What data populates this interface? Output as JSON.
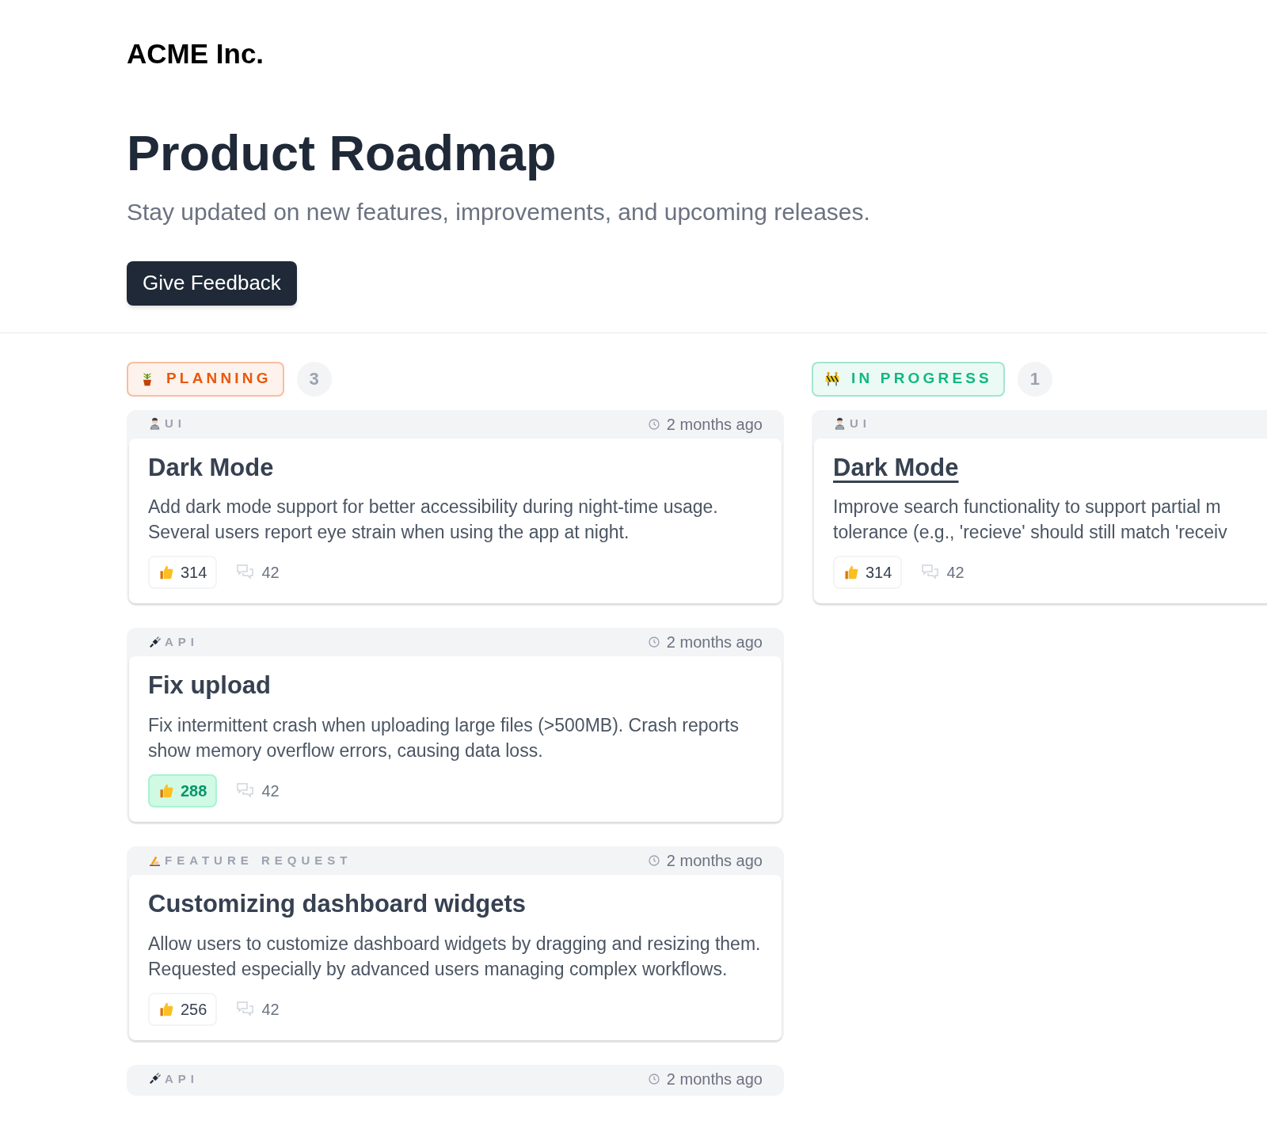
{
  "brand": "ACME Inc.",
  "title": "Product Roadmap",
  "subtitle": "Stay updated on new features, improvements, and upcoming releases.",
  "feedback_button": "Give Feedback",
  "columns": [
    {
      "kind": "planning",
      "label": "PLANNING",
      "color": "#ea580c",
      "count": "3",
      "cards": [
        {
          "tag": {
            "kind": "ui",
            "label": "UI"
          },
          "time": "2 months ago",
          "title": "Dark Mode",
          "hovered": false,
          "description": "Add dark mode support for better accessibility during night-time usage. Several users report eye strain when using the app at night.",
          "votes": "314",
          "voted": false,
          "comments": "42"
        },
        {
          "tag": {
            "kind": "api",
            "label": "API"
          },
          "time": "2 months ago",
          "title": "Fix upload",
          "hovered": false,
          "description": "Fix intermittent crash when uploading large files (>500MB). Crash reports show memory overflow errors, causing data loss.",
          "votes": "288",
          "voted": true,
          "comments": "42"
        },
        {
          "tag": {
            "kind": "feature",
            "label": "FEATURE REQUEST"
          },
          "time": "2 months ago",
          "title": "Customizing dashboard widgets",
          "hovered": false,
          "description": "Allow users to customize dashboard widgets by dragging and resizing them. Requested especially by advanced users managing complex workflows.",
          "votes": "256",
          "voted": false,
          "comments": "42"
        },
        {
          "tag": {
            "kind": "api",
            "label": "API"
          },
          "time": "2 months ago"
        }
      ]
    },
    {
      "kind": "progress",
      "label": "IN PROGRESS",
      "color": "#10b981",
      "count": "1",
      "cards": [
        {
          "tag": {
            "kind": "ui",
            "label": "UI"
          },
          "title": "Dark Mode",
          "hovered": true,
          "description_lines": [
            "Improve search functionality to support partial m",
            "tolerance (e.g., 'recieve' should still match 'receiv"
          ],
          "votes": "314",
          "voted": false,
          "comments": "42"
        }
      ]
    }
  ]
}
